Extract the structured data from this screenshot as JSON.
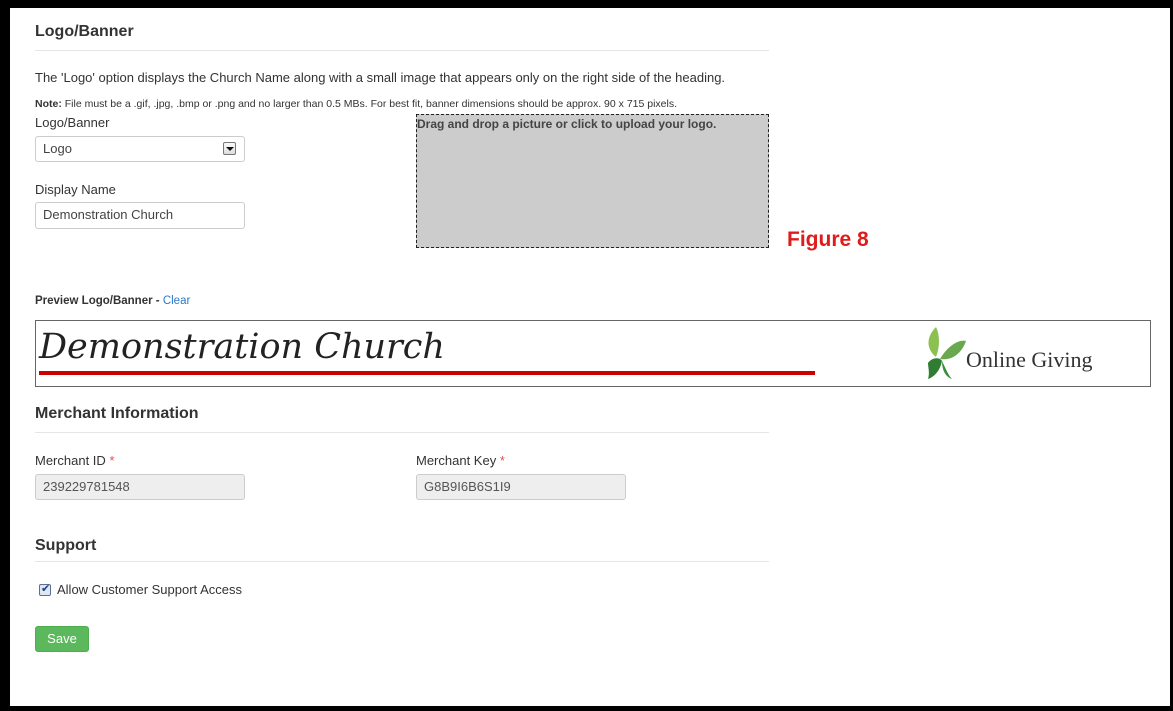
{
  "logo_section": {
    "heading": "Logo/Banner",
    "description": "The 'Logo' option displays the Church Name along with a small image that appears only on the right side of the heading.",
    "note_label": "Note:",
    "note_text": " File must be a .gif, .jpg, .bmp or .png and no larger than 0.5 MBs. For best fit, banner dimensions should be approx. 90 x 715 pixels.",
    "type_label": "Logo/Banner",
    "type_value": "Logo",
    "display_name_label": "Display Name",
    "display_name_value": "Demonstration Church",
    "dropzone_text": "Drag and drop a picture or click to upload your logo.",
    "figure_caption": "Figure 8"
  },
  "preview": {
    "label": "Preview Logo/Banner -",
    "clear_link": "Clear",
    "church_name": "Demonstration Church",
    "brand_text": "Online Giving",
    "accent_color": "#c00000",
    "brand_green": "#6aa84f"
  },
  "merchant": {
    "heading": "Merchant Information",
    "id_label": "Merchant ID",
    "id_value": "239229781548",
    "key_label": "Merchant Key",
    "key_value": "G8B9I6B6S1I9",
    "required_marker": "*"
  },
  "support": {
    "heading": "Support",
    "checkbox_label": "Allow Customer Support Access",
    "checkbox_checked": true
  },
  "actions": {
    "save_label": "Save",
    "save_color": "#5cb85c"
  }
}
